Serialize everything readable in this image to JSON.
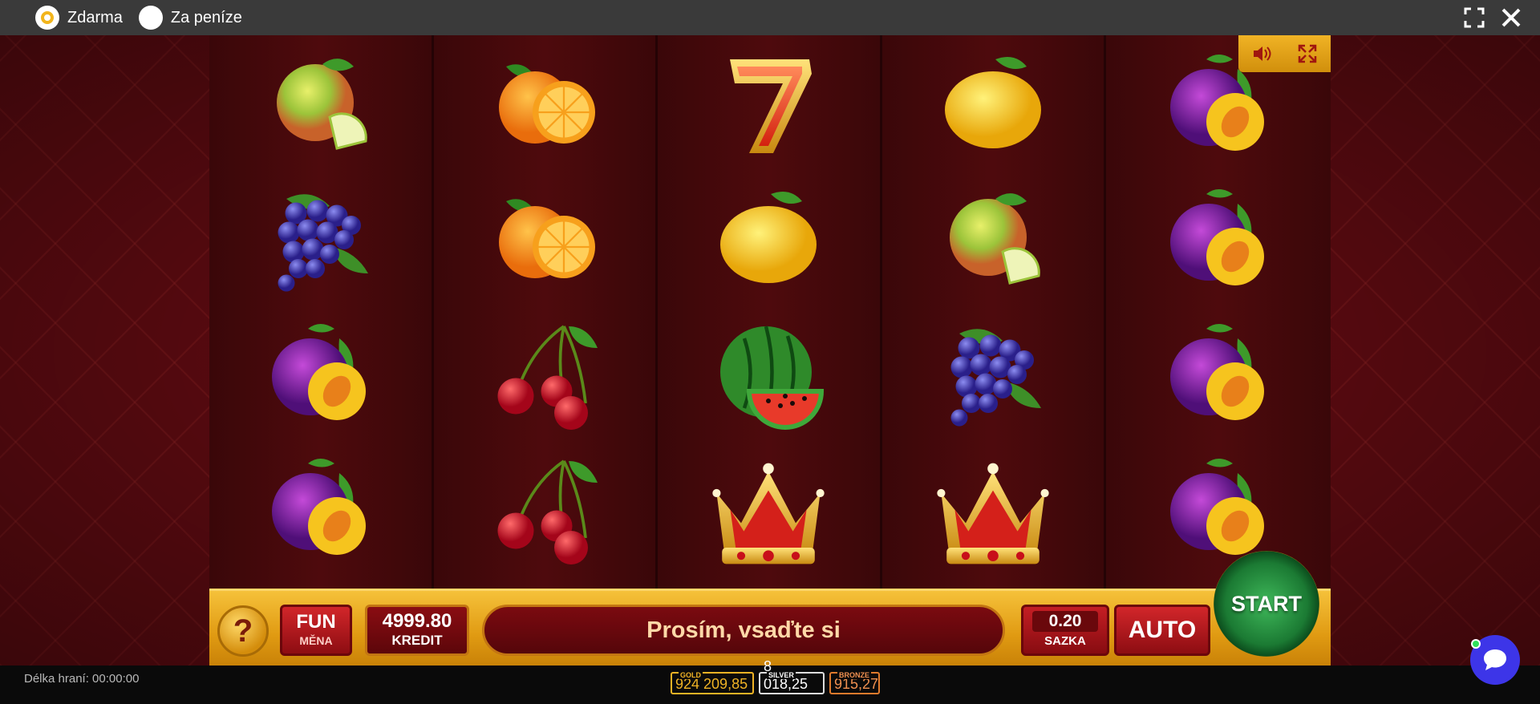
{
  "topbar": {
    "options": [
      {
        "label": "Zdarma",
        "selected": true
      },
      {
        "label": "Za peníze",
        "selected": false
      }
    ],
    "icons": [
      "fullscreen-icon",
      "close-icon"
    ]
  },
  "game": {
    "reels": [
      [
        "apple",
        "grapes",
        "plum",
        "plum"
      ],
      [
        "orange",
        "orange",
        "cherries",
        "cherries"
      ],
      [
        "seven",
        "lemon",
        "watermelon",
        "crown"
      ],
      [
        "lemon",
        "apple",
        "grapes",
        "crown"
      ],
      [
        "plum",
        "plum",
        "plum",
        "plum"
      ]
    ],
    "panel_icons": [
      "speaker-icon",
      "expand-icon"
    ]
  },
  "controls": {
    "help_label": "?",
    "currency_value": "FUN",
    "currency_label": "MĚNA",
    "credit_value": "4999.80",
    "credit_label": "KREDIT",
    "message": "Prosím, vsaďte si",
    "bet_value": "0.20",
    "bet_label": "SAZKA",
    "auto_label": "AUTO",
    "start_label": "START"
  },
  "footer": {
    "duration": "Délka hraní: 00:00:00",
    "jackpots": [
      {
        "name": "GOLD",
        "value": "924 209,85"
      },
      {
        "name": "SILVER",
        "value": "8 018,25"
      },
      {
        "name": "BRONZE",
        "value": "915,27"
      }
    ]
  },
  "colors": {
    "accent": "#f2b51c",
    "stage_bg": "#5a0a10",
    "start_green": "#1b7a33",
    "chat": "#3d35e8"
  }
}
